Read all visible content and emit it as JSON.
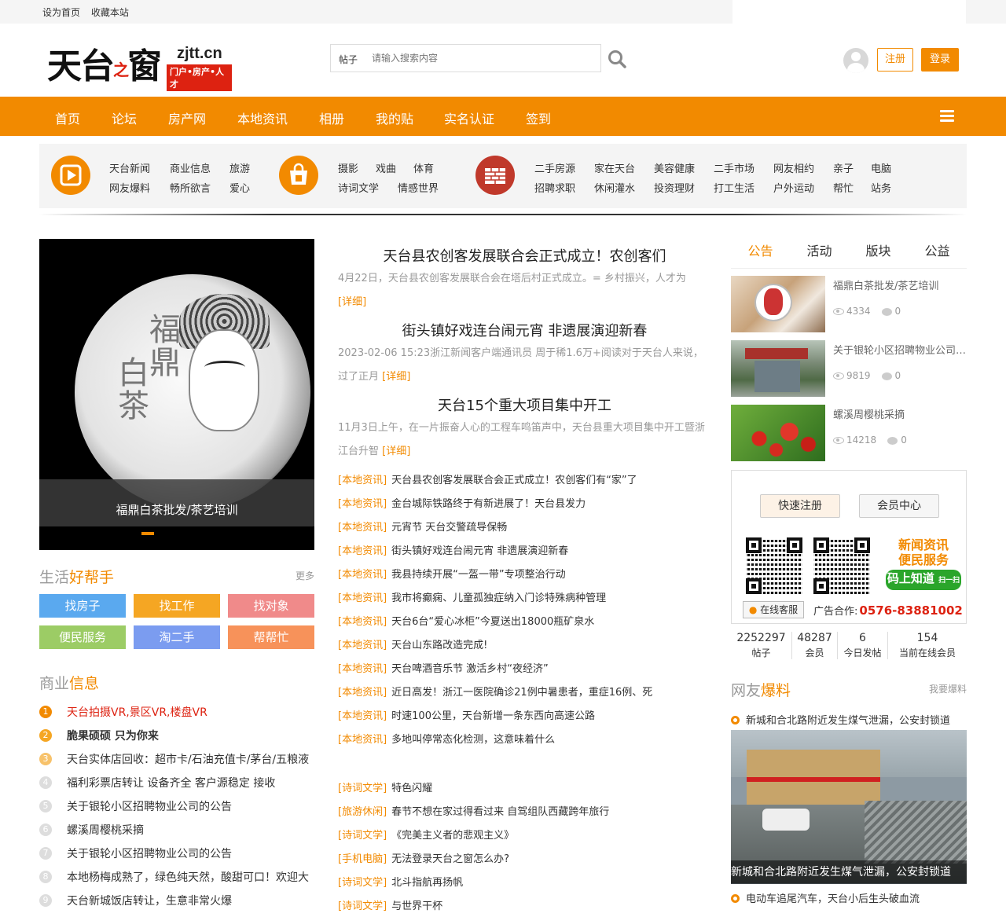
{
  "topbar": {
    "set_home": "设为首页",
    "bookmark": "收藏本站"
  },
  "logo": {
    "name": "天台之窗",
    "domain": "zjtt.cn",
    "tagline": "门户•房产•人才"
  },
  "search": {
    "type_label": "帖子",
    "placeholder": "请输入搜索内容"
  },
  "auth": {
    "register": "注册",
    "login": "登录"
  },
  "nav": [
    "首页",
    "论坛",
    "房产网",
    "本地资讯",
    "相册",
    "我的贴",
    "实名认证",
    "签到"
  ],
  "categories": {
    "group1": [
      "天台新闻",
      "商业信息",
      "旅游",
      "网友爆料",
      "畅所欲言",
      "爱心"
    ],
    "group2": [
      "摄影",
      "戏曲",
      "体育",
      "诗词文学",
      "情感世界"
    ],
    "group3": [
      "二手房源",
      "家在天台",
      "美容健康",
      "二手市场",
      "网友相约",
      "亲子",
      "电脑",
      "招聘求职",
      "休闲灌水",
      "投资理财",
      "打工生活",
      "户外运动",
      "帮忙",
      "站务"
    ]
  },
  "slider": {
    "caption": "福鼎白茶批发/茶艺培训",
    "image_text_1": "白茶",
    "image_text_2": "福鼎"
  },
  "life_helper": {
    "title_gray": "生活",
    "title_orange": "好帮手",
    "more": "更多",
    "buttons": [
      "找房子",
      "找工作",
      "找对象",
      "便民服务",
      "淘二手",
      "帮帮忙"
    ]
  },
  "business": {
    "title_gray": "商业",
    "title_orange": "信息",
    "items": [
      {
        "n": "1",
        "text": "天台拍摄VR,景区VR,楼盘VR"
      },
      {
        "n": "2",
        "text": "脆果硕硕 只为你来"
      },
      {
        "n": "3",
        "text": "天台实体店回收：超市卡/石油充值卡/茅台/五粮液"
      },
      {
        "n": "4",
        "text": "福利彩票店转让 设备齐全 客户源稳定 接收"
      },
      {
        "n": "5",
        "text": "关于银轮小区招聘物业公司的公告"
      },
      {
        "n": "6",
        "text": "螺溪周樱桃采摘"
      },
      {
        "n": "7",
        "text": "关于银轮小区招聘物业公司的公告"
      },
      {
        "n": "8",
        "text": "本地杨梅成熟了，绿色纯天然，酸甜可口！欢迎大"
      },
      {
        "n": "9",
        "text": "天台新城饭店转让，生意非常火爆"
      }
    ]
  },
  "headlines": [
    {
      "title": "天台县农创客发展联合会正式成立！农创客们",
      "summary": "4月22日，天台县农创客发展联合会在塔后村正式成立。= 乡村振兴，人才为",
      "detail": "[详细]"
    },
    {
      "title": "街头镇好戏连台闹元宵 非遗展演迎新春",
      "summary": "2023-02-06 15:23浙江新闻客户端通讯员 周于稀1.6万+阅读对于天台人来说，过了正月",
      "detail": "[详细]"
    },
    {
      "title": "天台15个重大项目集中开工",
      "summary": "11月3日上午，在一片振奋人心的工程车鸣笛声中，天台县重大项目集中开工暨浙江台升智",
      "detail": "[详细]"
    }
  ],
  "local_news": [
    {
      "tag": "[本地资讯]",
      "title": "天台县农创客发展联合会正式成立！农创客们有“家”了"
    },
    {
      "tag": "[本地资讯]",
      "title": "金台城际铁路终于有新进展了！天台县发力"
    },
    {
      "tag": "[本地资讯]",
      "title": "元宵节 天台交警疏导保畅"
    },
    {
      "tag": "[本地资讯]",
      "title": "街头镇好戏连台闹元宵 非遗展演迎新春"
    },
    {
      "tag": "[本地资讯]",
      "title": "我县持续开展“一盔一带”专项整治行动"
    },
    {
      "tag": "[本地资讯]",
      "title": "我市将癫痫、儿童孤独症纳入门诊特殊病种管理"
    },
    {
      "tag": "[本地资讯]",
      "title": "天台6台“爱心冰柜”今夏送出18000瓶矿泉水"
    },
    {
      "tag": "[本地资讯]",
      "title": "天台山东路改造完成!"
    },
    {
      "tag": "[本地资讯]",
      "title": "天台啤酒音乐节 激活乡村“夜经济”"
    },
    {
      "tag": "[本地资讯]",
      "title": "近日高发！浙江一医院确诊21例中暑患者，重症16例、死"
    },
    {
      "tag": "[本地资讯]",
      "title": "时速100公里，天台新增一条东西向高速公路"
    },
    {
      "tag": "[本地资讯]",
      "title": "多地叫停常态化检测，这意味着什么"
    }
  ],
  "forum_news": [
    {
      "tag": "[诗词文学]",
      "title": "特色闪耀"
    },
    {
      "tag": "[旅游休闲]",
      "title": "春节不想在家过得看过来 自驾组队西藏跨年旅行"
    },
    {
      "tag": "[诗词文学]",
      "title": "《完美主义者的悲观主义》"
    },
    {
      "tag": "[手机电脑]",
      "title": "无法登录天台之窗怎么办?"
    },
    {
      "tag": "[诗词文学]",
      "title": "北斗指航再扬帆"
    },
    {
      "tag": "[诗词文学]",
      "title": "与世界干杯"
    }
  ],
  "tabs": [
    "公告",
    "活动",
    "版块",
    "公益"
  ],
  "posts": [
    {
      "title": "福鼎白茶批发/茶艺培训",
      "views": "4334",
      "comments": "0"
    },
    {
      "title": "关于银轮小区招聘物业公司的公告",
      "views": "9819",
      "comments": "0"
    },
    {
      "title": "螺溪周樱桃采摘",
      "views": "14218",
      "comments": "0"
    }
  ],
  "member": {
    "quick_register": "快速注册",
    "member_center": "会员中心",
    "slogan_1": "新闻资讯",
    "slogan_2": "便民服务",
    "slogan_3": "码上知道",
    "scan": "扫一扫",
    "online_service": "在线客服",
    "ad_label": "广告合作:",
    "phone": "0576-83881002"
  },
  "stats": [
    {
      "value": "2252297",
      "label": "帖子"
    },
    {
      "value": "48287",
      "label": "会员"
    },
    {
      "value": "6",
      "label": "今日发帖"
    },
    {
      "value": "154",
      "label": "当前在线会员"
    }
  ],
  "tipoff": {
    "title_gray": "网友",
    "title_orange": "爆料",
    "more": "我要爆料",
    "items": [
      "新城和合北路附近发生煤气泄漏，公安封锁道",
      "电动车追尾汽车，天台小后生头破血流"
    ],
    "image_caption": "新城和合北路附近发生煤气泄漏，公安封锁道"
  },
  "colors": {
    "accent": "#f28a00",
    "red": "#dd2211",
    "helper_blue": "#5aa9ef",
    "helper_orange": "#f5a623",
    "helper_pink": "#f08a8a",
    "helper_green": "#9ccc65",
    "helper_lblue": "#7b9cf0",
    "helper_coral": "#f7925a"
  }
}
